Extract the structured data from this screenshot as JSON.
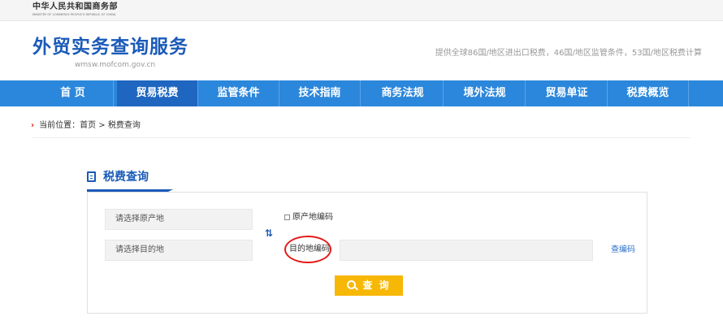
{
  "ministry": {
    "name_cn": "中华人民共和国商务部",
    "name_en": "MINISTRY OF COMMERCE PEOPLE'S REPUBLIC OF CHINA"
  },
  "site": {
    "title": "外贸实务查询服务",
    "url": "wmsw.mofcom.gov.cn",
    "tagline": "提供全球86国/地区进出口税费，46国/地区监管条件，53国/地区税费计算"
  },
  "nav": {
    "items": [
      {
        "label": "首 页"
      },
      {
        "label": "贸易税费"
      },
      {
        "label": "监管条件"
      },
      {
        "label": "技术指南"
      },
      {
        "label": "商务法规"
      },
      {
        "label": "境外法规"
      },
      {
        "label": "贸易单证"
      },
      {
        "label": "税费概览"
      }
    ],
    "active_index": 1
  },
  "breadcrumb": {
    "text": "当前位置：首页 > 税费查询"
  },
  "panel": {
    "title": "税费查询",
    "origin_placeholder": "请选择原产地",
    "destination_placeholder": "请选择目的地",
    "origin_code_label": "原产地编码",
    "destination_code_label": "目的地编码",
    "destination_code_value": "",
    "lookup_link": "查编码",
    "query_button": "查 询"
  },
  "colors": {
    "brand_blue": "#1a5ab8",
    "nav_blue": "#2b87db",
    "active_nav": "#1e66c0",
    "query_yellow": "#f7b705",
    "annotation_red": "#e31b1b"
  },
  "icons": {
    "breadcrumb": "chevron-right-icon",
    "panel_title": "document-icon",
    "swap": "swap-icon",
    "query": "search-icon"
  }
}
